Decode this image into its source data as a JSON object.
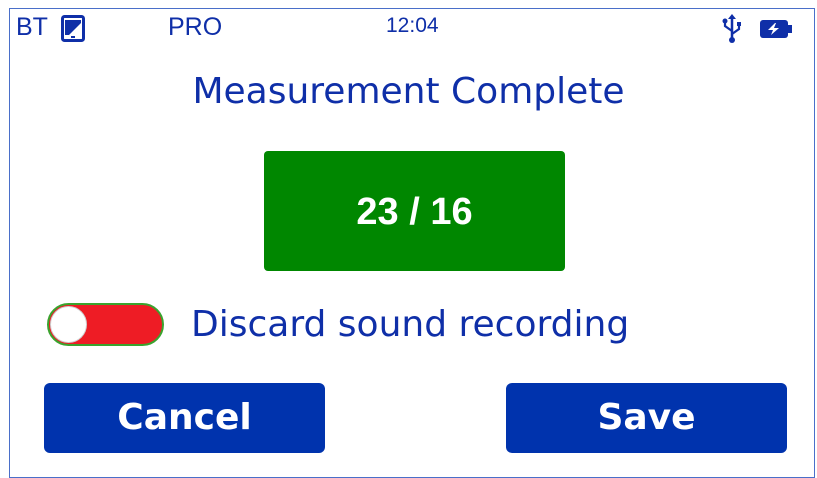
{
  "status_bar": {
    "bt_label": "BT",
    "mode_label": "PRO",
    "time": "12:04",
    "icons": [
      "phone-icon",
      "usb-icon",
      "battery-charging-icon"
    ]
  },
  "title": "Measurement Complete",
  "result": {
    "value": "23 / 16",
    "background_color": "#008700"
  },
  "discard_toggle": {
    "label": "Discard sound recording",
    "state": "off",
    "track_color": "#ee1c25"
  },
  "buttons": {
    "cancel_label": "Cancel",
    "save_label": "Save",
    "color": "#0033ad"
  },
  "colors": {
    "text": "#0f2fa8",
    "accent": "#0033ad"
  }
}
